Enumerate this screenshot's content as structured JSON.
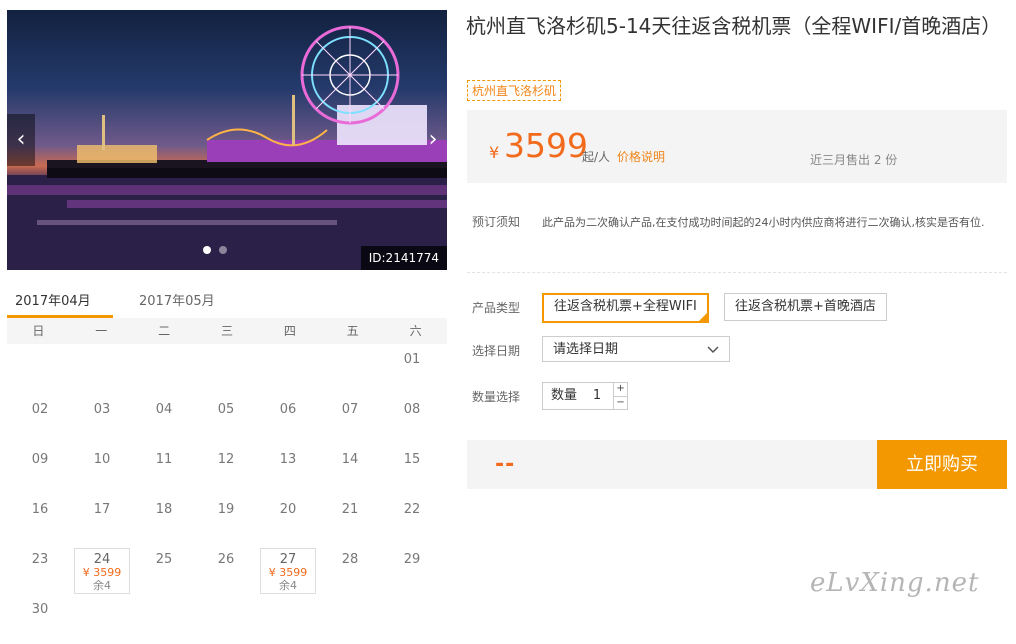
{
  "gallery": {
    "image_id": "ID:2141774",
    "prev_icon": "chevron-left-icon",
    "next_icon": "chevron-right-icon",
    "prev_glyph": "‹",
    "next_glyph": "›",
    "slide_count": 2,
    "active_slide": 1
  },
  "calendar": {
    "tabs": [
      "2017年04月",
      "2017年05月"
    ],
    "active_tab": 0,
    "weekdays": [
      "日",
      "一",
      "二",
      "三",
      "四",
      "五",
      "六"
    ],
    "days": [
      {
        "day": "01",
        "col": 6,
        "row": 0
      },
      {
        "day": "02",
        "col": 0,
        "row": 1
      },
      {
        "day": "03",
        "col": 1,
        "row": 1
      },
      {
        "day": "04",
        "col": 2,
        "row": 1
      },
      {
        "day": "05",
        "col": 3,
        "row": 1
      },
      {
        "day": "06",
        "col": 4,
        "row": 1
      },
      {
        "day": "07",
        "col": 5,
        "row": 1
      },
      {
        "day": "08",
        "col": 6,
        "row": 1
      },
      {
        "day": "09",
        "col": 0,
        "row": 2
      },
      {
        "day": "10",
        "col": 1,
        "row": 2
      },
      {
        "day": "11",
        "col": 2,
        "row": 2
      },
      {
        "day": "12",
        "col": 3,
        "row": 2
      },
      {
        "day": "13",
        "col": 4,
        "row": 2
      },
      {
        "day": "14",
        "col": 5,
        "row": 2
      },
      {
        "day": "15",
        "col": 6,
        "row": 2
      },
      {
        "day": "16",
        "col": 0,
        "row": 3
      },
      {
        "day": "17",
        "col": 1,
        "row": 3
      },
      {
        "day": "18",
        "col": 2,
        "row": 3
      },
      {
        "day": "19",
        "col": 3,
        "row": 3
      },
      {
        "day": "20",
        "col": 4,
        "row": 3
      },
      {
        "day": "21",
        "col": 5,
        "row": 3
      },
      {
        "day": "22",
        "col": 6,
        "row": 3
      },
      {
        "day": "23",
        "col": 0,
        "row": 4
      },
      {
        "day": "24",
        "col": 1,
        "row": 4,
        "price": "¥ 3599",
        "remain": "余4"
      },
      {
        "day": "25",
        "col": 2,
        "row": 4
      },
      {
        "day": "26",
        "col": 3,
        "row": 4
      },
      {
        "day": "27",
        "col": 4,
        "row": 4,
        "price": "¥ 3599",
        "remain": "余4"
      },
      {
        "day": "28",
        "col": 5,
        "row": 4
      },
      {
        "day": "29",
        "col": 6,
        "row": 4
      },
      {
        "day": "30",
        "col": 0,
        "row": 5
      }
    ]
  },
  "product": {
    "title": "杭州直飞洛杉矶5-14天往返含税机票（全程WIFI/首晚酒店）",
    "tag": "杭州直飞洛杉矶"
  },
  "price": {
    "currency": "¥",
    "amount": "3599",
    "unit": "起/人",
    "note_link": "价格说明",
    "sold": "近三月售出 2 份"
  },
  "booking": {
    "label": "预订须知",
    "text": "此产品为二次确认产品,在支付成功时间起的24小时内供应商将进行二次确认,核实是否有位."
  },
  "options": {
    "type_label": "产品类型",
    "types": [
      "往返含税机票+全程WIFI",
      "往返含税机票+首晚酒店"
    ],
    "selected_type": 0,
    "date_label": "选择日期",
    "date_placeholder": "请选择日期",
    "date_icon": "chevron-down-icon",
    "qty_label": "数量选择",
    "qty_inner_label": "数量",
    "qty_value": "1",
    "qty_plus": "+",
    "qty_minus": "−"
  },
  "checkout": {
    "total": "--",
    "buy_label": "立即购买"
  },
  "watermark": "eLvXing.net",
  "colors": {
    "accent": "#f39800",
    "price": "#f26a1b"
  }
}
